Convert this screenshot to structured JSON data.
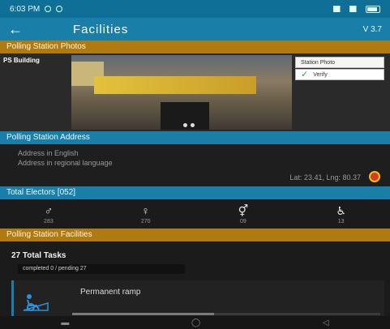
{
  "status_bar": {
    "time": "6:03 PM"
  },
  "app_bar": {
    "back_icon": "back-arrow-icon",
    "title": "Facilities",
    "version": "V 3.7"
  },
  "photos_section": {
    "header": "Polling Station Photos",
    "building_label": "PS Building",
    "station_photo_label": "Station Photo",
    "verify_label": "Verify",
    "dots": 2
  },
  "address_section": {
    "header": "Polling Station Address",
    "english": "Address in English",
    "regional": "Address in regional language",
    "latlng": "Lat: 23.41, Lng: 80.37",
    "pin_icon": "location-pin-icon"
  },
  "electors_section": {
    "header": "Total Electors [052]",
    "items": [
      {
        "icon": "male-icon",
        "glyph": "♂",
        "value": "283"
      },
      {
        "icon": "female-icon",
        "glyph": "♀",
        "value": "270"
      },
      {
        "icon": "third-gender-icon",
        "glyph": "⚥",
        "value": "09"
      },
      {
        "icon": "wheelchair-icon",
        "glyph": "♿",
        "value": "13"
      }
    ]
  },
  "facilities_section": {
    "header": "Polling Station Facilities",
    "total_tasks": "27 Total Tasks",
    "sub_status": "completed 0 / pending 27",
    "card_label": "Permanent ramp",
    "progress_pct": 46
  },
  "nav_bar": {
    "menu_icon": "recents-icon",
    "home_icon": "home-icon",
    "back_icon": "nav-back-icon"
  },
  "colors": {
    "primary": "#1a7fa8",
    "section_gold": "#b07a12",
    "check": "#22a845"
  }
}
